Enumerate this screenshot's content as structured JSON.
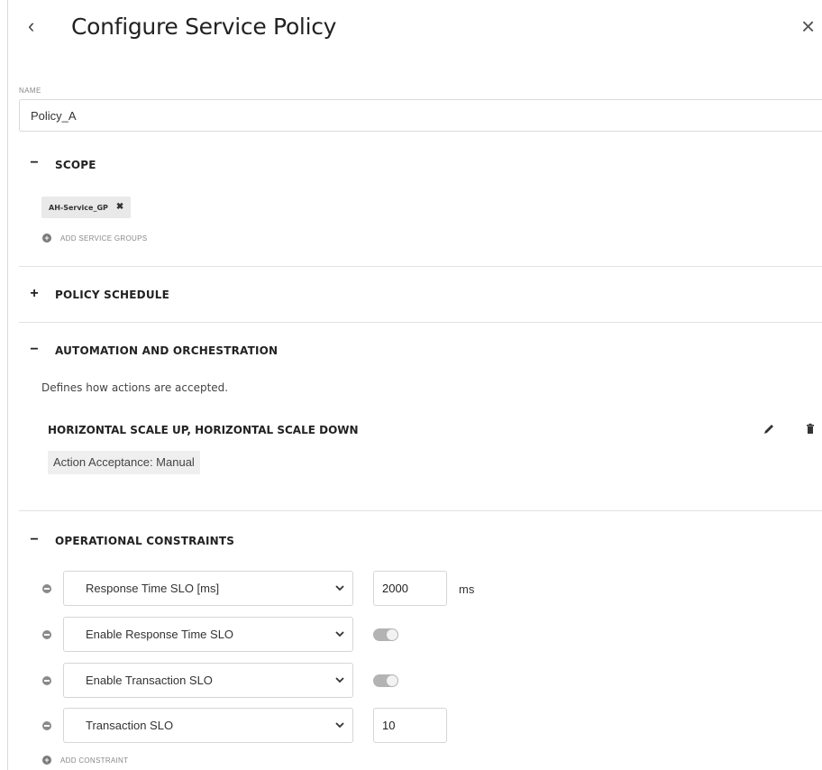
{
  "header": {
    "back_icon": "chevron-left-icon",
    "title": "Configure Service Policy",
    "close_icon": "close-icon"
  },
  "name_field": {
    "label": "NAME",
    "value": "Policy_A"
  },
  "sections": {
    "scope": {
      "toggle": "−",
      "title": "SCOPE",
      "chips": [
        {
          "label": "AH-Service_GP",
          "remove": "✖"
        }
      ],
      "add_label": "ADD SERVICE GROUPS"
    },
    "policy_schedule": {
      "toggle": "+",
      "title": "POLICY SCHEDULE"
    },
    "automation": {
      "toggle": "−",
      "title": "AUTOMATION AND ORCHESTRATION",
      "description": "Defines how actions are accepted.",
      "rule_title": "HORIZONTAL SCALE UP, HORIZONTAL SCALE DOWN",
      "acceptance": "Action Acceptance: Manual",
      "edit_icon": "pencil-icon",
      "delete_icon": "trash-icon"
    },
    "constraints": {
      "toggle": "−",
      "title": "OPERATIONAL CONSTRAINTS",
      "rows": [
        {
          "select": "Response Time SLO [ms]",
          "kind": "input",
          "value": "2000",
          "unit": "ms"
        },
        {
          "select": "Enable Response Time SLO",
          "kind": "toggle",
          "value": "on"
        },
        {
          "select": "Enable Transaction SLO",
          "kind": "toggle",
          "value": "on"
        },
        {
          "select": "Transaction SLO",
          "kind": "input",
          "value": "10"
        }
      ],
      "add_label": "ADD CONSTRAINT"
    }
  },
  "colors": {
    "divider": "#e2e2e2",
    "chip_bg": "#e9e9e9",
    "toggle_track": "#b3b3b3",
    "tag_bg": "#efefef"
  }
}
